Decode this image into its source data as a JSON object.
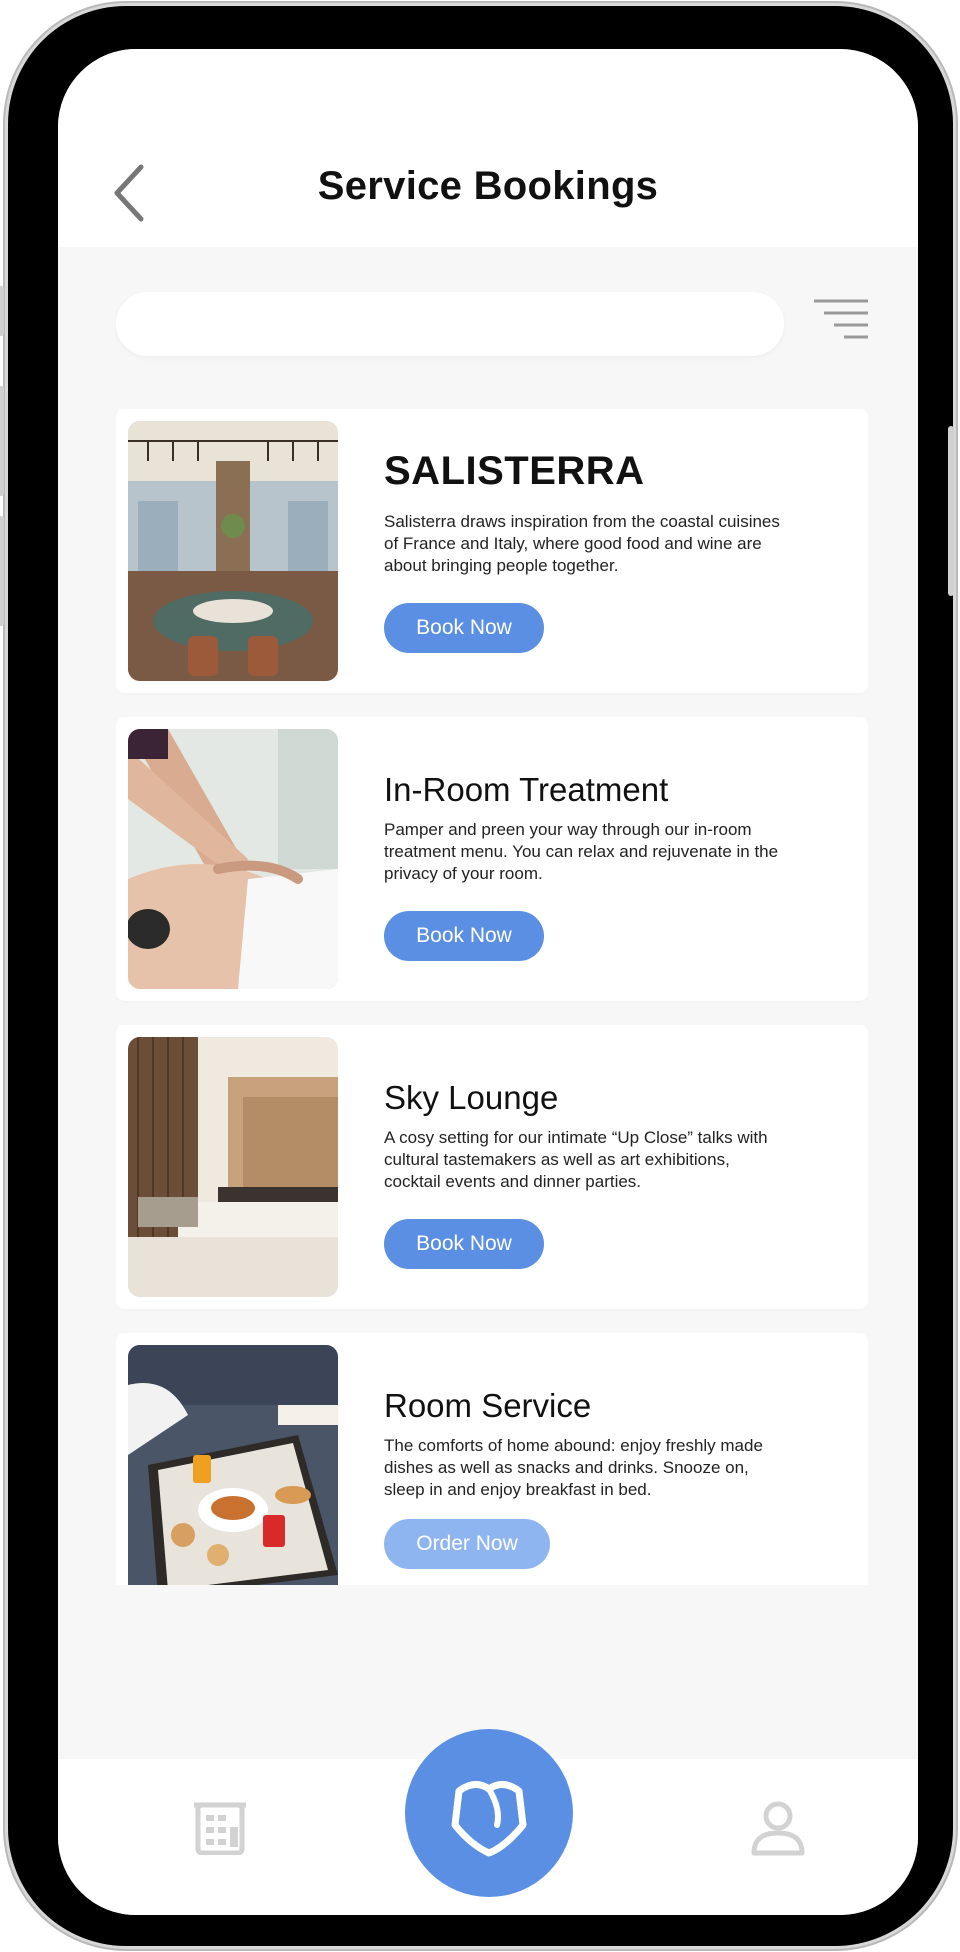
{
  "header": {
    "title": "Service Bookings",
    "back_icon": "chevron-left-icon"
  },
  "search": {
    "placeholder": "",
    "value": ""
  },
  "filter_icon": "filter-lines-icon",
  "services": [
    {
      "name": "SALISTERRA",
      "description": "Salisterra draws inspiration from the coastal cuisines of France and Italy, where good food and wine are about bringing people together.",
      "button_label": "Book Now",
      "image": "restaurant-interior-image"
    },
    {
      "name": "In-Room Treatment",
      "description": "Pamper and preen your way through our in-room treatment menu. You can relax and rejuvenate in the privacy of your room.",
      "button_label": "Book Now",
      "image": "massage-image"
    },
    {
      "name": "Sky Lounge",
      "description": "A cosy setting for our intimate “Up Close” talks with cultural tastemakers as well as art exhibitions, cocktail events and dinner parties.",
      "button_label": "Book Now",
      "image": "lounge-fireplace-image"
    },
    {
      "name": "Room Service",
      "description": "The comforts of home abound: enjoy freshly made dishes as well as snacks and drinks. Snooze on, sleep in and enjoy breakfast in bed.",
      "button_label": "Order Now",
      "image": "breakfast-tray-image"
    }
  ],
  "bottom_nav": {
    "left_icon": "building-icon",
    "center_icon": "shield-heart-icon",
    "right_icon": "user-icon"
  },
  "colors": {
    "accent": "#5b8fe3",
    "accent_light": "#8fb5f0",
    "background": "#f7f7f7"
  }
}
